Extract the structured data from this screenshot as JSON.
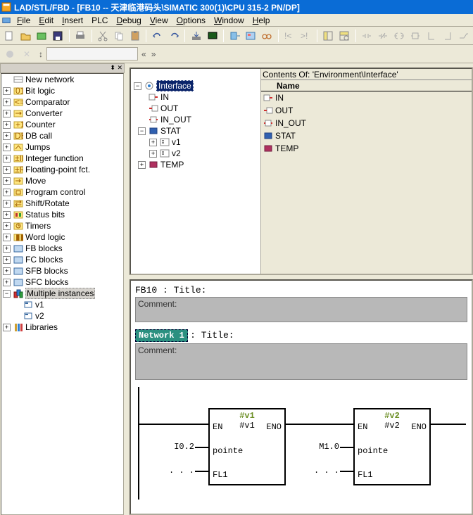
{
  "title": "LAD/STL/FBD  - [FB10 -- 天津临港码头\\SIMATIC 300(1)\\CPU 315-2 PN/DP]",
  "menu": {
    "file": "File",
    "edit": "Edit",
    "insert": "Insert",
    "plc": "PLC",
    "debug": "Debug",
    "view": "View",
    "options": "Options",
    "window": "Window",
    "help": "Help"
  },
  "catalog": {
    "new_network": "New network",
    "bit_logic": "Bit logic",
    "comparator": "Comparator",
    "converter": "Converter",
    "counter": "Counter",
    "db_call": "DB call",
    "jumps": "Jumps",
    "integer_function": "Integer function",
    "float_fct": "Floating-point fct.",
    "move": "Move",
    "program_control": "Program control",
    "shift_rotate": "Shift/Rotate",
    "status_bits": "Status bits",
    "timers": "Timers",
    "word_logic": "Word logic",
    "fb_blocks": "FB blocks",
    "fc_blocks": "FC blocks",
    "sfb_blocks": "SFB blocks",
    "sfc_blocks": "SFC blocks",
    "multi_inst": "Multiple instances",
    "v1": "v1",
    "v2": "v2",
    "libraries": "Libraries"
  },
  "interface_panel": {
    "header": "Contents Of: 'Environment\\Interface'",
    "name_col": "Name",
    "tree_root": "Interface",
    "items": [
      "IN",
      "OUT",
      "IN_OUT",
      "STAT",
      "TEMP"
    ],
    "stat_children": [
      "v1",
      "v2"
    ]
  },
  "code": {
    "fb_title": "FB10 : Title:",
    "comment_label": "Comment:",
    "network_label": "Network 1",
    "title_suffix": ": Title:",
    "blocks": [
      {
        "name": "#v1",
        "type": "#v1",
        "en": "EN",
        "eno": "ENO",
        "in1": "I0.2",
        "in1lbl": "pointe",
        "in2": ". . .",
        "in2lbl": "FL1"
      },
      {
        "name": "#v2",
        "type": "#v2",
        "en": "EN",
        "eno": "ENO",
        "in1": "M1.0",
        "in1lbl": "pointe",
        "in2": ". . .",
        "in2lbl": "FL1"
      }
    ]
  }
}
